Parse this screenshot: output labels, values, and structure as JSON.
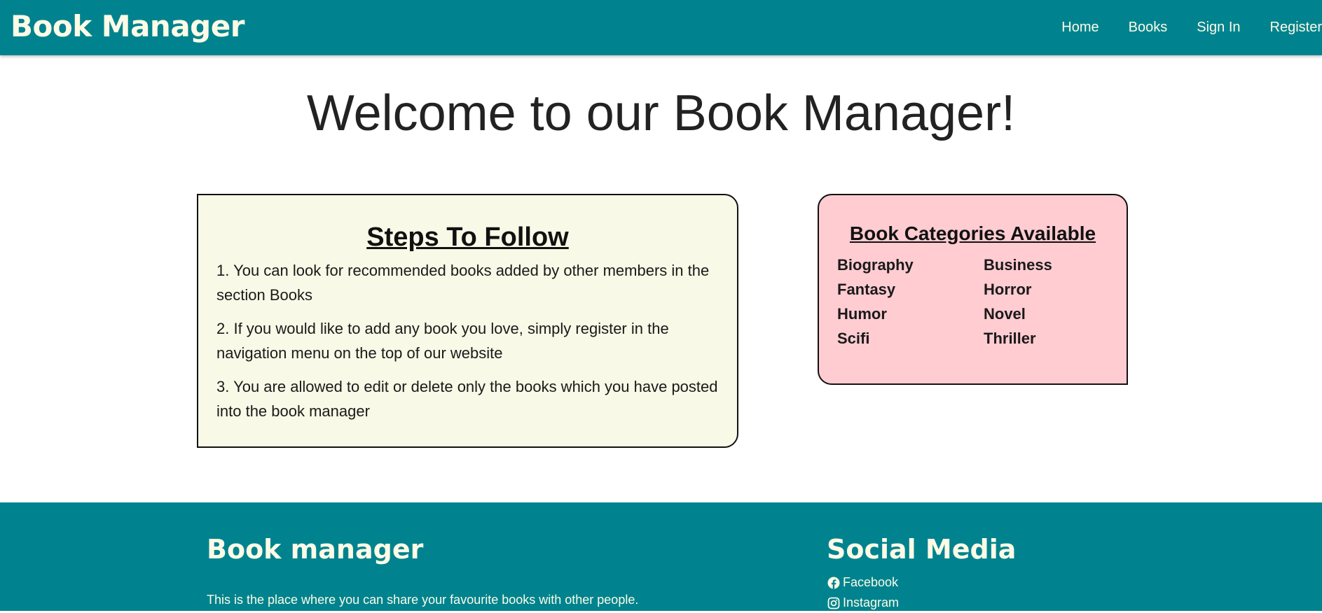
{
  "header": {
    "brand": "Book Manager",
    "nav": [
      {
        "label": "Home"
      },
      {
        "label": "Books"
      },
      {
        "label": "Sign In"
      },
      {
        "label": "Register"
      }
    ]
  },
  "main": {
    "title": "Welcome to our Book Manager!",
    "steps_card": {
      "title": "Steps To Follow",
      "steps": [
        "1. You can look for recommended books added by other members in the section Books",
        "2. If you would like to add any book you love, simply register in the navigation menu on the top of our website",
        "3. You are allowed to edit or delete only the books which you have posted into the book manager"
      ]
    },
    "categories_card": {
      "title": "Book Categories Available",
      "categories": [
        "Biography",
        "Business",
        "Fantasy",
        "Horror",
        "Humor",
        "Novel",
        "Scifi",
        "Thriller"
      ]
    }
  },
  "footer": {
    "left_title": "Book manager",
    "description": "This is the place where you can share your favourite books with other people.",
    "right_title": "Social Media",
    "social": [
      {
        "label": "Facebook",
        "icon": "facebook-icon"
      },
      {
        "label": "Instagram",
        "icon": "instagram-icon"
      }
    ]
  },
  "colors": {
    "primary": "#00838f",
    "header_text": "#fdfbe6",
    "steps_card_bg": "#f8f9e6",
    "categories_card_bg": "#ffccd2"
  }
}
